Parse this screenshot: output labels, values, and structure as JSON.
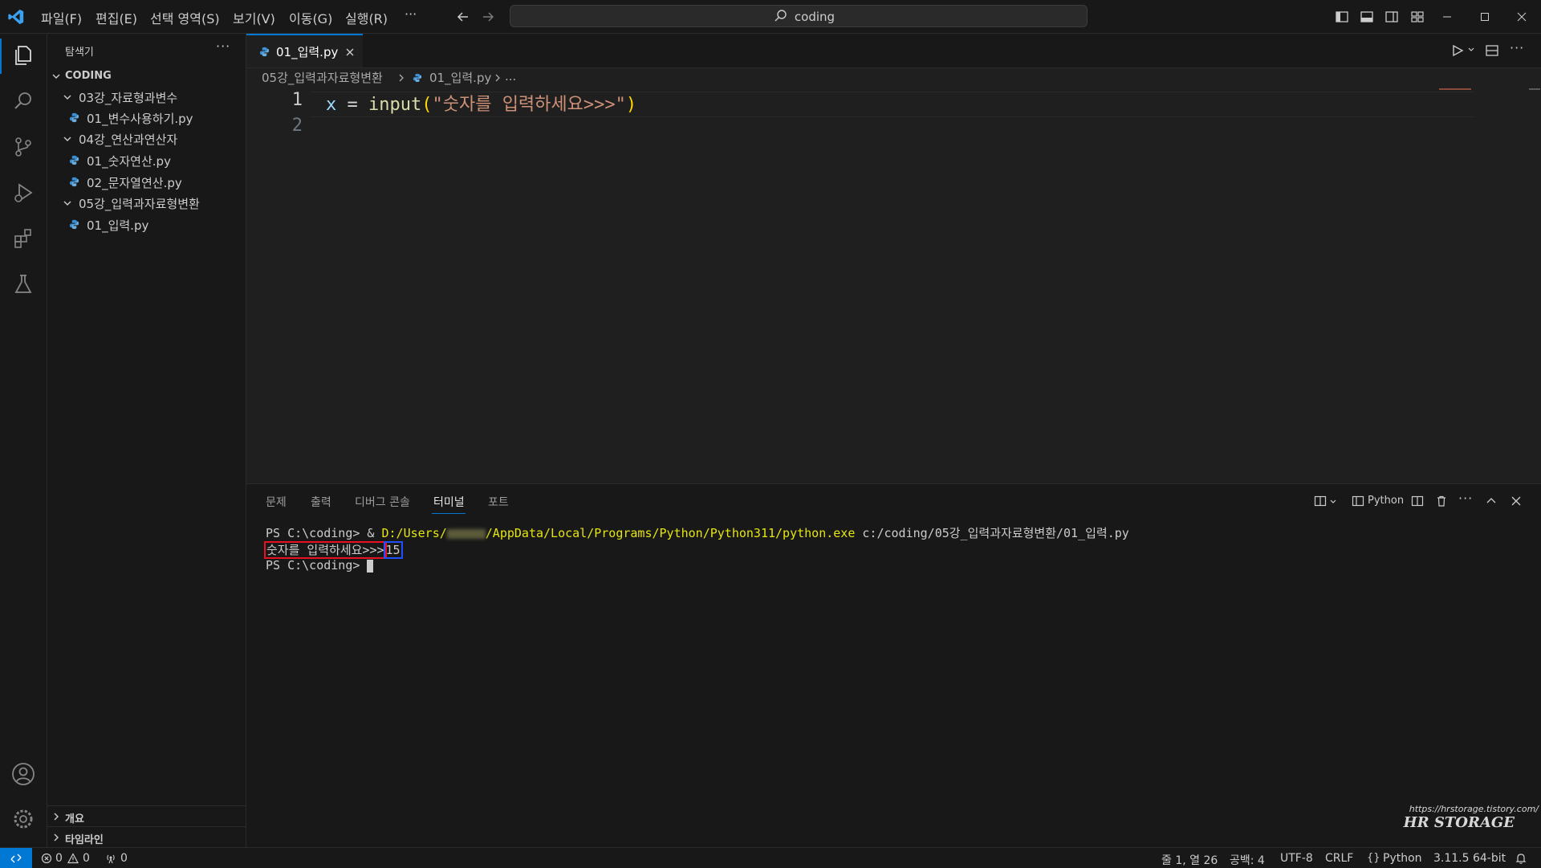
{
  "menu": [
    "파일(F)",
    "편집(E)",
    "선택 영역(S)",
    "보기(V)",
    "이동(G)",
    "실행(R)",
    "···"
  ],
  "search": {
    "label": "coding"
  },
  "sidebar": {
    "title": "탐색기",
    "root": "CODING",
    "tree": [
      {
        "label": "03강_자료형과변수",
        "kind": "folder"
      },
      {
        "label": "01_변수사용하기.py",
        "kind": "file"
      },
      {
        "label": "04강_연산과연산자",
        "kind": "folder"
      },
      {
        "label": "01_숫자연산.py",
        "kind": "file"
      },
      {
        "label": "02_문자열연산.py",
        "kind": "file"
      },
      {
        "label": "05강_입력과자료형변환",
        "kind": "folder"
      },
      {
        "label": "01_입력.py",
        "kind": "file"
      }
    ],
    "outline": "개요",
    "timeline": "타임라인"
  },
  "editor": {
    "tab_label": "01_입력.py",
    "breadcrumb": {
      "folder": "05강_입력과자료형변환",
      "file": "01_입력.py",
      "more": "..."
    },
    "line_numbers": [
      "1",
      "2"
    ],
    "code": {
      "var": "x",
      "op": " = ",
      "func": "input",
      "open": "(",
      "string": "\"숫자를 입력하세요>>>\"",
      "close": ")"
    }
  },
  "panel": {
    "tabs": [
      "문제",
      "출력",
      "디버그 콘솔",
      "터미널",
      "포트"
    ],
    "active_tab": "터미널",
    "shell_label": "Python",
    "terminal": {
      "line1_prompt": "PS C:\\coding> & ",
      "line1_path_a": "D:/Users/",
      "line1_path_b": "/AppData/Local/Programs/Python/Python311/python.exe",
      "line1_arg": " c:/coding/05강_입력과자료형변환/01_입력.py",
      "line2_prompt": "숫자를 입력하세요>>>",
      "line2_input": "15",
      "line3_prompt": "PS C:\\coding> "
    }
  },
  "watermark": {
    "url": "https://hrstorage.tistory.com/",
    "name": "HR STORAGE"
  },
  "statusbar": {
    "errors": "0",
    "warnings": "0",
    "ports": "0",
    "position": "줄 1, 열 26",
    "spaces": "공백: 4",
    "encoding": "UTF-8",
    "eol": "CRLF",
    "language": "Python",
    "interpreter": "3.11.5 64-bit"
  },
  "colors": {
    "accent": "#0078d4",
    "string": "#ce9178",
    "function": "#dcdcaa",
    "variable": "#9cdcfe",
    "terminal_path": "#e5e510",
    "highlight_red": "#e81123",
    "highlight_blue": "#1f4fff"
  }
}
